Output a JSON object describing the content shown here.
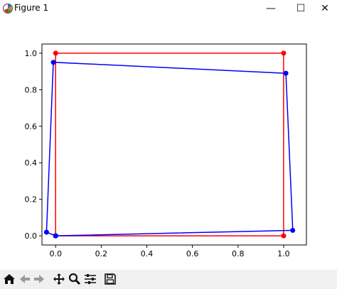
{
  "window": {
    "title": "Figure 1",
    "controls": {
      "minimize": "—",
      "maximize": "☐",
      "close": "✕"
    }
  },
  "toolbar": {
    "buttons": [
      {
        "name": "home-icon",
        "tip": "Reset original view"
      },
      {
        "name": "back-icon",
        "tip": "Back to previous view"
      },
      {
        "name": "forward-icon",
        "tip": "Forward to next view"
      },
      {
        "name": "pan-icon",
        "tip": "Pan axes"
      },
      {
        "name": "zoom-icon",
        "tip": "Zoom to rectangle"
      },
      {
        "name": "configure-subplots-icon",
        "tip": "Configure subplots"
      },
      {
        "name": "save-icon",
        "tip": "Save the figure"
      }
    ]
  },
  "chart_data": {
    "type": "line",
    "title": "",
    "xlabel": "",
    "ylabel": "",
    "xlim": [
      -0.06,
      1.1
    ],
    "ylim": [
      -0.05,
      1.05
    ],
    "xticks": [
      "0.0",
      "0.2",
      "0.4",
      "0.6",
      "0.8",
      "1.0"
    ],
    "yticks": [
      "0.0",
      "0.2",
      "0.4",
      "0.6",
      "0.8",
      "1.0"
    ],
    "grid": false,
    "series": [
      {
        "color": "#ff0000",
        "marker": "circle",
        "points": [
          [
            0,
            0
          ],
          [
            1,
            0
          ],
          [
            1,
            1
          ],
          [
            0,
            1
          ],
          [
            0,
            0
          ]
        ]
      },
      {
        "color": "#0000ff",
        "marker": "circle",
        "points": [
          [
            0,
            0
          ],
          [
            1.04,
            0.03
          ],
          [
            1.01,
            0.89
          ],
          [
            -0.01,
            0.95
          ],
          [
            -0.04,
            0.02
          ],
          [
            0,
            0
          ]
        ]
      }
    ]
  }
}
